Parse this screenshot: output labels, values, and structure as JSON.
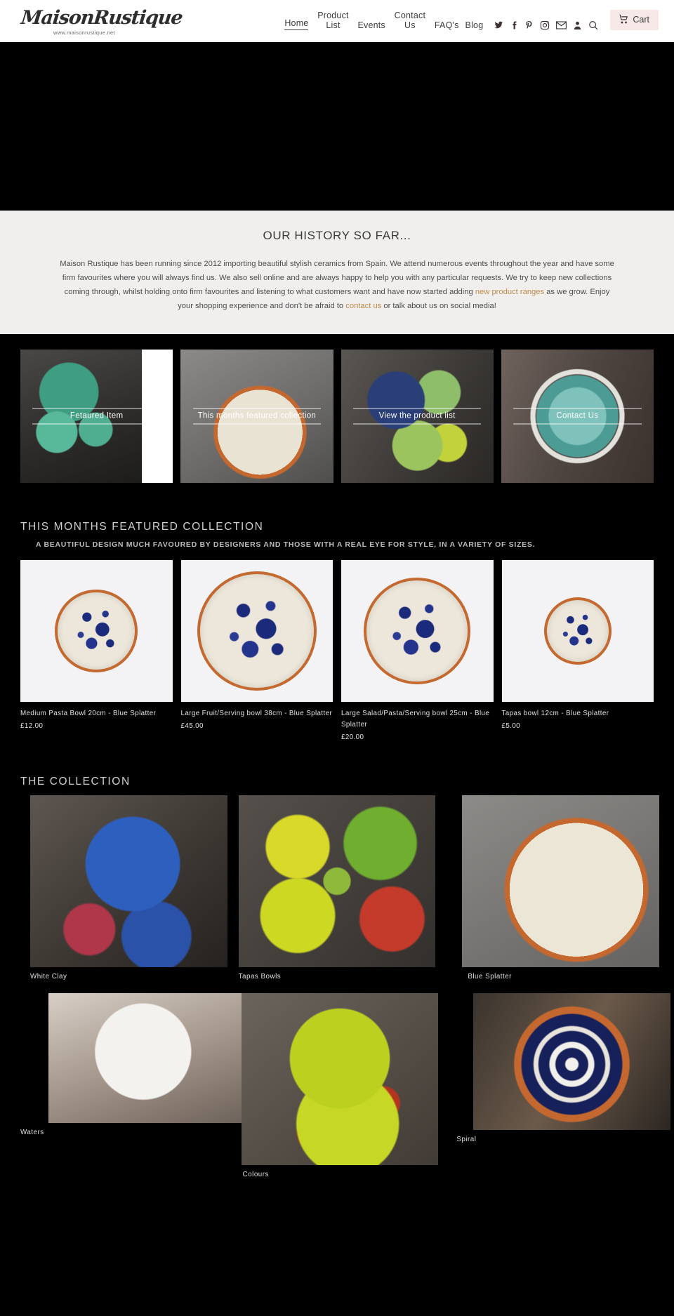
{
  "header": {
    "logo_text": "MaisonRustique",
    "logo_url": "www.maisonrustique.net",
    "nav": [
      {
        "label": "Home",
        "active": true
      },
      {
        "label": "Product List",
        "active": false
      },
      {
        "label": "Events",
        "active": false
      },
      {
        "label": "Contact Us",
        "active": false
      },
      {
        "label": "FAQ's",
        "active": false
      },
      {
        "label": "Blog",
        "active": false
      }
    ],
    "icons": [
      "twitter-icon",
      "facebook-icon",
      "pinterest-icon",
      "instagram-icon",
      "email-icon",
      "account-icon",
      "search-icon"
    ],
    "cart_label": "Cart",
    "cart_bg": "#f6e9e8"
  },
  "history": {
    "title": "OUR HISTORY SO FAR...",
    "p1": "Maison Rustique has been running since 2012 importing beautiful stylish ceramics from Spain.  We attend numerous events throughout the year and have some firm favourites where you will always find us.  We also sell online and are always happy to help you with any particular requests.  We try to keep new collections coming through, whilst holding onto firm favourites and listening to what customers want and have now started adding ",
    "link1": "new product ranges",
    "p2": " as we grow.  Enjoy your shopping experience and don't be afraid to ",
    "link2": "contact us",
    "p3": " or talk about us on social media!",
    "link_color": "#c08b4a",
    "bg": "#f0efee"
  },
  "tiles": [
    {
      "caption": "Fetaured Item",
      "photo": "green-jugs-photo"
    },
    {
      "caption": "This months featured collection",
      "photo": "blue-splatter-bowl-photo"
    },
    {
      "caption": "View the product list",
      "photo": "lime-bowls-photo"
    },
    {
      "caption": "Contact Us",
      "photo": "teal-bowls-photo"
    }
  ],
  "featured": {
    "title": "THIS MONTHS FEATURED COLLECTION",
    "subtitle": "A BEAUTIFUL DESIGN MUCH FAVOURED BY DESIGNERS AND THOSE WITH A REAL EYE FOR STYLE, IN A VARIETY OF SIZES.",
    "products": [
      {
        "title": "Medium Pasta Bowl 20cm - Blue Splatter",
        "price": "£12.00"
      },
      {
        "title": "Large Fruit/Serving bowl 38cm - Blue Splatter",
        "price": "£45.00"
      },
      {
        "title": "Large Salad/Pasta/Serving bowl 25cm - Blue Splatter",
        "price": "£20.00"
      },
      {
        "title": "Tapas bowl 12cm - Blue Splatter",
        "price": "£5.00"
      }
    ]
  },
  "collection": {
    "title": "THE COLLECTION",
    "items": [
      {
        "label": "White Clay",
        "photo": "blue-jug-bowls-photo"
      },
      {
        "label": "Tapas Bowls",
        "photo": "tapas-bowls-photo"
      },
      {
        "label": "Blue Splatter",
        "photo": "blue-splatter-photo"
      },
      {
        "label": "Waters",
        "photo": "waters-hands-photo"
      },
      {
        "label": "Colours",
        "photo": "colours-lime-bowls-photo"
      },
      {
        "label": "Spiral",
        "photo": "spiral-bowls-photo"
      }
    ]
  }
}
